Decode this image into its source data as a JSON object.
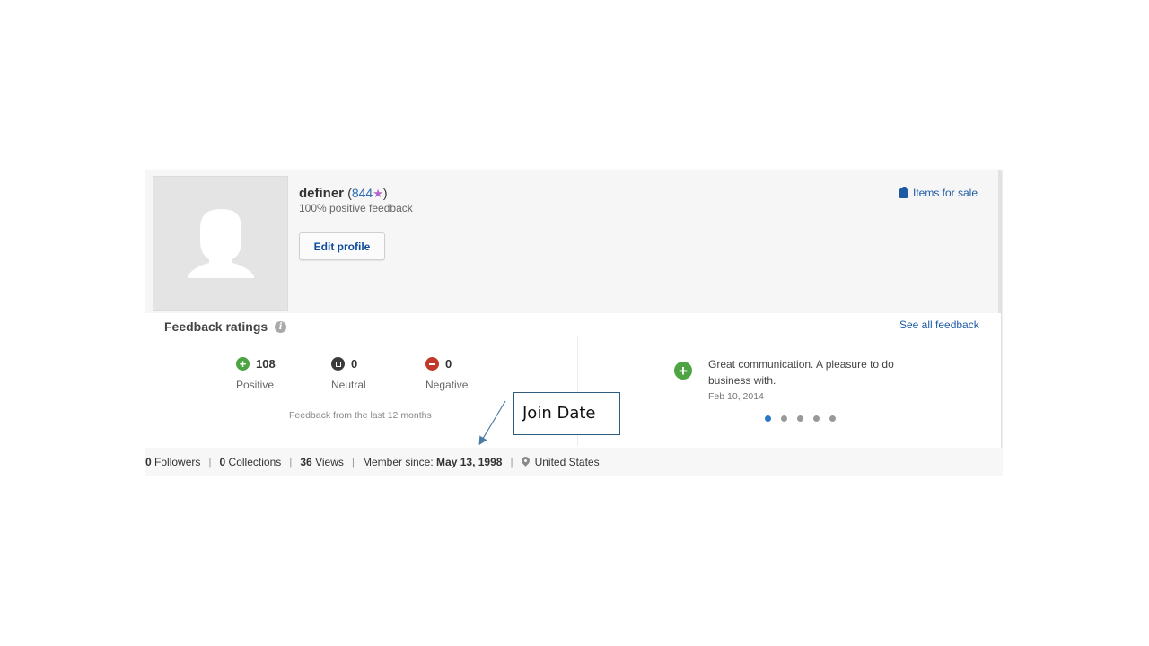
{
  "profile": {
    "username": "definer",
    "score_open": "(",
    "score": "844",
    "score_star": "★",
    "score_close": ")",
    "positive_feedback": "100% positive feedback",
    "edit_button": "Edit profile",
    "items_for_sale": "Items for sale",
    "icons": {
      "avatar": "default-user-silhouette",
      "items": "shopping-bag-icon"
    }
  },
  "feedback": {
    "title": "Feedback ratings",
    "info_icon": "i",
    "see_all": "See all feedback",
    "ratings": [
      {
        "name": "positive",
        "count": "108",
        "label": "Positive",
        "color": "#4ca443"
      },
      {
        "name": "neutral",
        "count": "0",
        "label": "Neutral",
        "color": "#3b3b3b"
      },
      {
        "name": "negative",
        "count": "0",
        "label": "Negative",
        "color": "#c0392b"
      }
    ],
    "period_note": "Feedback from the last 12 months",
    "latest_comment": {
      "icon": "+",
      "text": "Great communication. A pleasure to do business with.",
      "date": "Feb 10, 2014"
    },
    "carousel": {
      "pages": 5,
      "active": 1
    }
  },
  "stats": {
    "followers_count": "0",
    "followers_label": "Followers",
    "collections_count": "0",
    "collections_label": "Collections",
    "views_count": "36",
    "views_label": "Views",
    "member_label": "Member since:",
    "member_date": "May 13, 1998",
    "location": "United States",
    "separator": "|"
  },
  "annotation": {
    "text": "Join Date"
  }
}
